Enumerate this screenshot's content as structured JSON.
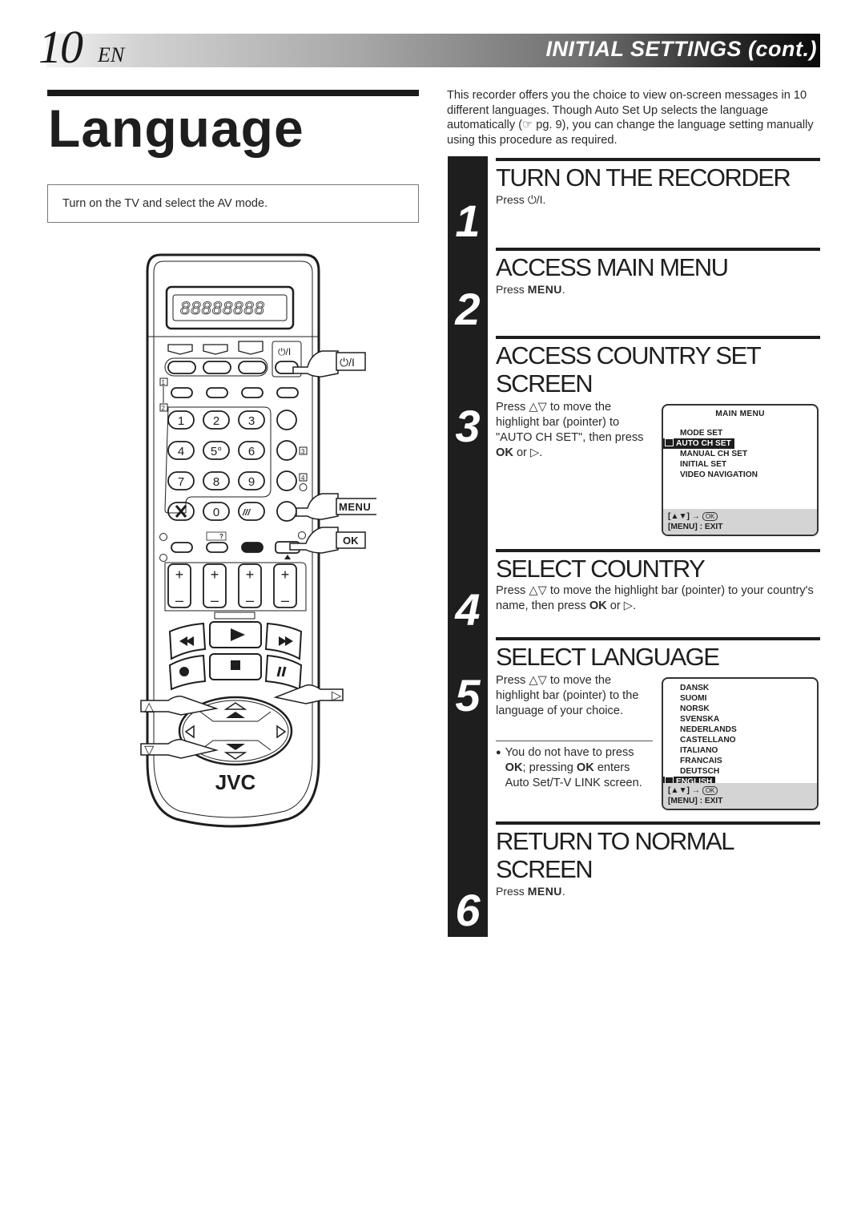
{
  "header": {
    "page_number": "10",
    "language_code": "EN",
    "section_title": "INITIAL SETTINGS (cont.)"
  },
  "title": "Language",
  "prerequisite": "Turn on the TV and select the AV mode.",
  "intro": "This recorder offers you the choice to view on-screen messages in 10 different languages. Though Auto Set Up selects the language automatically (☞ pg. 9), you can change the language setting manually using this procedure as required.",
  "steps": [
    {
      "number": "1",
      "heading": "TURN ON THE RECORDER",
      "text_prefix": "Press ",
      "text_key": "⏻/I",
      "text_suffix": "."
    },
    {
      "number": "2",
      "heading": "ACCESS MAIN MENU",
      "text_prefix": "Press ",
      "text_key": "MENU",
      "text_suffix": "."
    },
    {
      "number": "3",
      "heading_line1": "ACCESS COUNTRY SET",
      "heading_line2": "SCREEN",
      "text_prefix": "Press △▽ to move the highlight bar (pointer) to \"AUTO CH SET\", then press ",
      "text_key": "OK",
      "text_suffix": " or ▷."
    },
    {
      "number": "4",
      "heading": "SELECT COUNTRY",
      "text_prefix": "Press △▽ to move the highlight bar (pointer) to your country's name, then press ",
      "text_key": "OK",
      "text_suffix": " or ▷."
    },
    {
      "number": "5",
      "heading": "SELECT LANGUAGE",
      "text": "Press △▽ to move the highlight bar (pointer) to the language of your choice.",
      "note_bullet": "●",
      "note_p1": "You do not have to press ",
      "note_k1": "OK",
      "note_p2": "; pressing ",
      "note_k2": "OK",
      "note_p3": " enters Auto Set/T-V LINK screen."
    },
    {
      "number": "6",
      "heading_line1": "RETURN TO NORMAL",
      "heading_line2": "SCREEN",
      "text_prefix": "Press ",
      "text_key": "MENU",
      "text_suffix": "."
    }
  ],
  "main_menu_osd": {
    "title": "MAIN MENU",
    "items": [
      "MODE SET",
      "AUTO CH SET",
      "MANUAL CH SET",
      "INITIAL SET",
      "VIDEO NAVIGATION"
    ],
    "selected": "AUTO CH SET",
    "footer_nav": "[▲▼] →",
    "footer_ok": "OK",
    "footer_exit": "[MENU] : EXIT"
  },
  "language_osd": {
    "items": [
      "DANSK",
      "SUOMI",
      "NORSK",
      "SVENSKA",
      "NEDERLANDS",
      "CASTELLANO",
      "ITALIANO",
      "FRANCAIS",
      "DEUTSCH",
      "ENGLISH"
    ],
    "selected": "ENGLISH",
    "footer_nav": "[▲▼] →",
    "footer_ok": "OK",
    "footer_exit": "[MENU] : EXIT"
  },
  "remote": {
    "brand": "JVC",
    "callouts": {
      "power": "⏻/I",
      "menu": "MENU",
      "ok": "OK",
      "up": "△",
      "down": "▽",
      "right": "▷"
    },
    "keys": {
      "k1": "1",
      "k2": "2",
      "k3": "3",
      "k4": "4",
      "k5": "5°",
      "k6": "6",
      "k7": "7",
      "k8": "8",
      "k9": "9",
      "k0": "0"
    },
    "power_label": "⏻/I",
    "display": "88888888",
    "box_labels": {
      "b1": "1",
      "b2": "2",
      "b3": "3",
      "b4": "4"
    },
    "circle_labels": {
      "c1": "1",
      "c2": "2",
      "c3": "3",
      "c4": "4"
    },
    "plus": "+",
    "minus": "–",
    "help_label": "?"
  }
}
